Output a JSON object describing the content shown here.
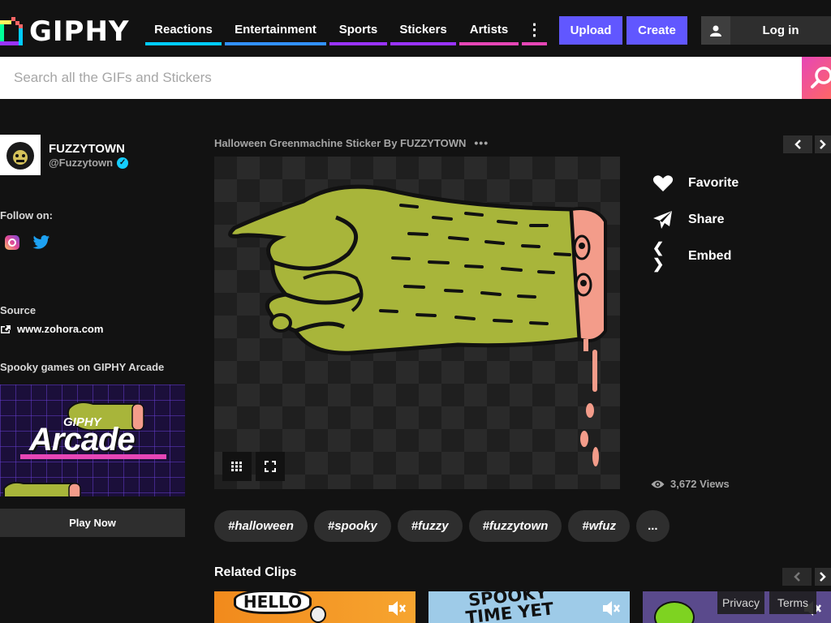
{
  "header": {
    "logo_text": "GIPHY",
    "nav": [
      {
        "label": "Reactions",
        "color": "#00ccff"
      },
      {
        "label": "Entertainment",
        "color": "#3191ff"
      },
      {
        "label": "Sports",
        "color": "#9933ff"
      },
      {
        "label": "Stickers",
        "color": "#9933ff"
      },
      {
        "label": "Artists",
        "color": "#e646b6"
      }
    ],
    "more_label": "⋮",
    "upload_label": "Upload",
    "create_label": "Create",
    "login_label": "Log in"
  },
  "search": {
    "placeholder": "Search all the GIFs and Stickers"
  },
  "sidebar": {
    "user_name": "FUZZYTOWN",
    "user_handle": "@Fuzzytown",
    "follow_label": "Follow on:",
    "source_label": "Source",
    "source_link": "www.zohora.com",
    "arcade_heading": "Spooky games on GIPHY Arcade",
    "arcade_brand_top": "GIPHY",
    "arcade_brand_main": "Arcade",
    "play_now_label": "Play Now"
  },
  "gif": {
    "title": "Halloween Greenmachine Sticker By FUZZYTOWN",
    "more_dots": "•••"
  },
  "actions": {
    "favorite_label": "Favorite",
    "share_label": "Share",
    "embed_label": "Embed",
    "embed_glyph": "❮ ❯",
    "views_text": "3,672 Views"
  },
  "tags": [
    "#halloween",
    "#spooky",
    "#fuzzy",
    "#fuzzytown",
    "#wfuz",
    "..."
  ],
  "related": {
    "title": "Related Clips",
    "clip1_text": "HELLO",
    "clip2_text": "SPOOKY TIME YET"
  },
  "footer": {
    "privacy_label": "Privacy",
    "terms_label": "Terms"
  },
  "colors": {
    "accent_purple": "#6157ff",
    "background": "#121212",
    "hand_green": "#a8b53a",
    "flesh_pink": "#f39c8a"
  }
}
